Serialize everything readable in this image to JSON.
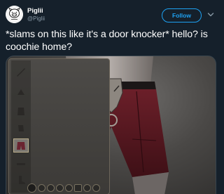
{
  "tweet": {
    "display_name": "Piglii",
    "handle": "@Piglii",
    "follow_label": "Follow",
    "text": "*slams on this like it's a door knocker* hello? is coochie home?"
  },
  "icons": {
    "avatar": "pig-avatar",
    "caret": "chevron-down-icon",
    "gear_slots": [
      "weapon-icon",
      "head-icon",
      "body-icon",
      "hands-icon",
      "waist-icon",
      "legs-icon",
      "feet-icon"
    ],
    "toolbar": [
      "brush-icon",
      "dye-icon",
      "refresh-icon",
      "lock-icon",
      "outfit-icon",
      "settings-icon",
      "glamour-icon",
      "close-icon"
    ]
  },
  "colors": {
    "background": "#15202b",
    "accent": "#1da1f2",
    "secondary_text": "#8899a6",
    "shorts": "#5a1a22",
    "belt": "#1b1717"
  }
}
